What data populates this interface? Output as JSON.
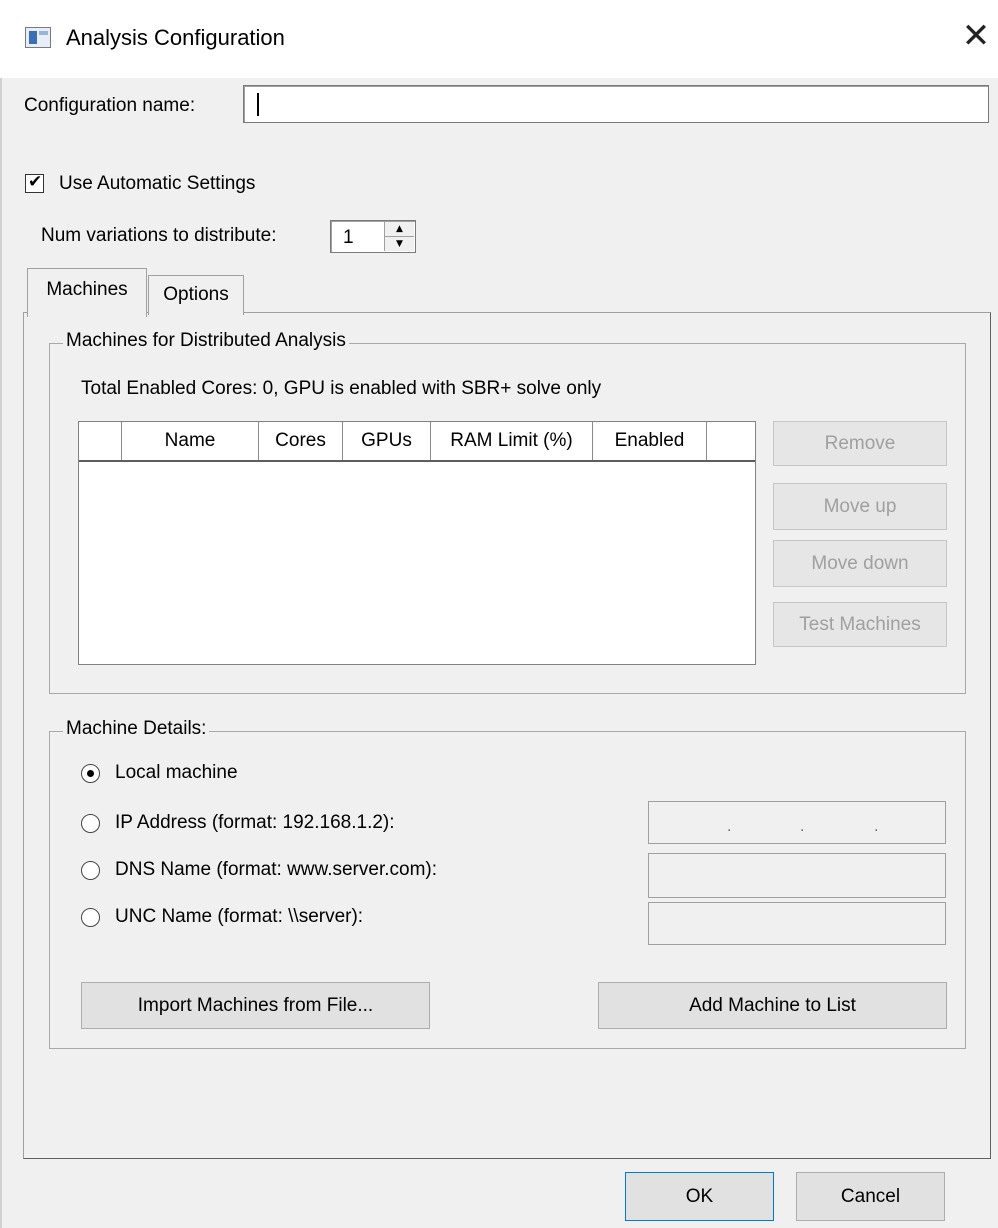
{
  "window": {
    "title": "Analysis Configuration",
    "close_glyph": "✕"
  },
  "config": {
    "name_label": "Configuration name:",
    "name_value": ""
  },
  "auto": {
    "label": "Use Automatic Settings",
    "checked": true,
    "check_glyph": "✔"
  },
  "num_variations": {
    "label": "Num variations to distribute:",
    "value": "1",
    "up_glyph": "▲",
    "down_glyph": "▼"
  },
  "tabs": {
    "machines": "Machines",
    "options": "Options",
    "active": "Machines"
  },
  "machines_group": {
    "legend": "Machines for Distributed Analysis",
    "total": "Total Enabled Cores: 0, GPU is enabled with SBR+ solve only",
    "columns": [
      "",
      "Name",
      "Cores",
      "GPUs",
      "RAM Limit (%)",
      "Enabled",
      ""
    ],
    "rows": [],
    "buttons": {
      "remove": "Remove",
      "move_up": "Move up",
      "move_down": "Move down",
      "test": "Test Machines"
    }
  },
  "details_group": {
    "legend": "Machine Details:",
    "options": {
      "local": "Local machine",
      "ip": "IP Address (format: 192.168.1.2):",
      "dns": "DNS Name (format: www.server.com):",
      "unc": "UNC Name (format: \\\\server):"
    },
    "selected": "local",
    "ip_dot": ".",
    "import_button": "Import Machines from File...",
    "add_button": "Add Machine to List"
  },
  "footer": {
    "ok": "OK",
    "cancel": "Cancel"
  },
  "colors": {
    "dialog_bg": "#f0f0f0",
    "disabled_text": "#a0a0a0",
    "focus_border": "#0078d7"
  }
}
